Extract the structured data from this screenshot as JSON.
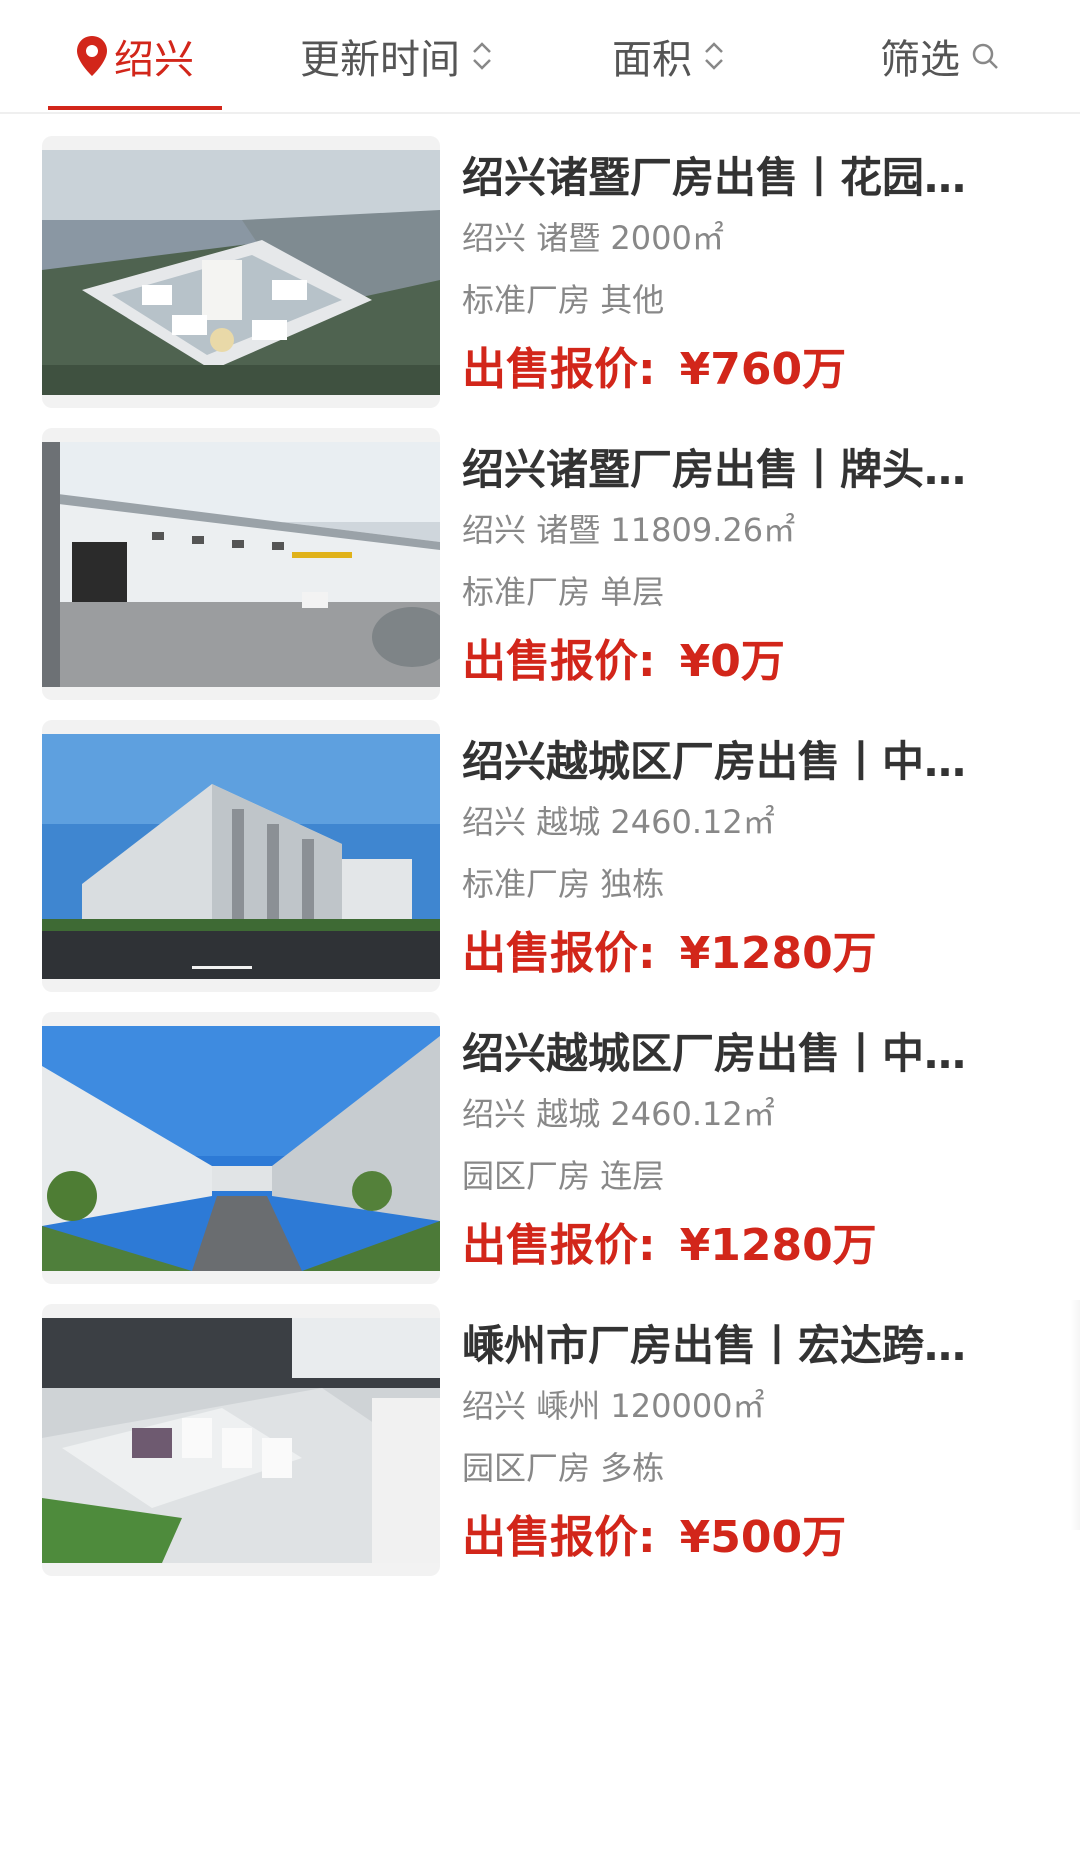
{
  "filters": {
    "location": "绍兴",
    "updated": "更新时间",
    "area": "面积",
    "filter": "筛选"
  },
  "listings": [
    {
      "title": "绍兴诸暨厂房出售丨花园…",
      "city": "绍兴",
      "district": "诸暨",
      "area": "2000㎡",
      "type": "标准厂房",
      "form": "其他",
      "price_label": "出售报价:",
      "price": "¥760万",
      "image": "industrial-park-aerial-render"
    },
    {
      "title": "绍兴诸暨厂房出售丨牌头…",
      "city": "绍兴",
      "district": "诸暨",
      "area": "11809.26㎡",
      "type": "标准厂房",
      "form": "单层",
      "price_label": "出售报价:",
      "price": "¥0万",
      "image": "single-storey-workshop-photo"
    },
    {
      "title": "绍兴越城区厂房出售丨中…",
      "city": "绍兴",
      "district": "越城",
      "area": "2460.12㎡",
      "type": "标准厂房",
      "form": "独栋",
      "price_label": "出售报价:",
      "price": "¥1280万",
      "image": "standalone-factory-photo"
    },
    {
      "title": "绍兴越城区厂房出售丨中…",
      "city": "绍兴",
      "district": "越城",
      "area": "2460.12㎡",
      "type": "园区厂房",
      "form": "连层",
      "price_label": "出售报价:",
      "price": "¥1280万",
      "image": "park-street-factories-photo"
    },
    {
      "title": "嵊州市厂房出售丨宏达跨…",
      "city": "绍兴",
      "district": "嵊州",
      "area": "120000㎡",
      "type": "园区厂房",
      "form": "多栋",
      "price_label": "出售报价:",
      "price": "¥500万",
      "image": "sand-table-model-photo"
    }
  ],
  "colors": {
    "accent": "#d2261a",
    "title": "#333333",
    "meta": "#888888"
  }
}
